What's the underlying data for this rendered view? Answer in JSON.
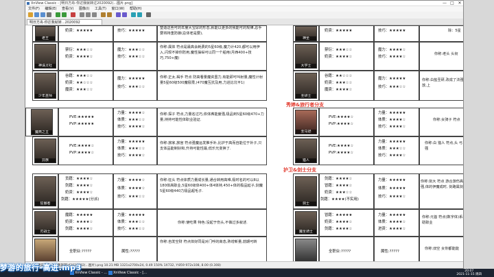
{
  "window": {
    "title": "XnView Classic - [明日方舟-你达我就转过2020092(...图片.png]",
    "tab_label": "明日方舟-你达我就转...2020092",
    "controls": {
      "minimize": "—",
      "maximize": "□",
      "close": "✕"
    }
  },
  "menu": [
    "文件(F)",
    "编辑(E)",
    "查看(V)",
    "图像(I)",
    "工具(T)",
    "窗口(W)",
    "帮助(H)"
  ],
  "sheet": {
    "sections": [
      {
        "name": "秀婷&旅行者分支"
      },
      {
        "name": "护卫&剑士分支"
      }
    ],
    "top_left_rows": [
      {
        "avatar_label": "老王",
        "stats": [
          "奶资：★★★★★"
        ],
        "skill": [
          "技巧：★★★★★"
        ],
        "desc": "塑造这些可的年度大宝尿的形态,就能以更多的我能可的规律,总手要将持重防御(总体老是要),"
      },
      {
        "avatar_label": "神诛灵社",
        "stats": [
          "禁衍：★★★☆☆",
          "奶资：★★★★☆"
        ],
        "skill": [
          "魔力：★★★☆☆",
          "技巧：★★★☆☆"
        ],
        "desc": "你称:属体 符点是最高会耗费的5星60级,魔力计420,都可以用伊入,闪现不掉你防用,魔性操纵可以同一个船用(月西400+技巧,750+魔)"
      },
      {
        "avatar_label": "少年巫师",
        "stats": [
          "谷籍：★★★☆☆",
          "奶资：★★☆☆☆",
          "魔资：★★★☆☆"
        ],
        "skill": [
          "魔力：★★★★★",
          "技巧：★★★☆☆"
        ],
        "desc": "你称:正太,褐手 符点 防高看量魔资虽力,有能即可叫射量,魔性计射量5星60级500魔极限,(470魔互抗及用,力进比坑平1)"
      },
      {
        "avatar_label": "魔燕之主",
        "stats": [
          "PVE:★★★★★",
          "PVP:★★★★★"
        ],
        "skill": [
          "力量：★★★★☆",
          "体质：★★★☆☆",
          "技巧：★★★★☆"
        ],
        "desc": "你称:探子 符点,力量名过巧,依体弗能度强,极品到5星60级470+力量,持持可能性体职业验证."
      },
      {
        "avatar_label": "异族",
        "stats": [
          "PVE:★★★★☆",
          "PVP:★★★★☆"
        ],
        "skill": [
          "力量：★★★★★",
          "体质：★★★☆☆",
          "技巧：★★★★☆"
        ],
        "desc": "你称:旅家,旅宫 符点强魔运发推手补,比护于高而自能位于补子,只支体品能制好和,升持可能性最,低乐光变换了."
      },
      {
        "avatar_label": "狂傲者",
        "stats": [
          "贡籍：★★★★☆",
          "剑籍：★★★★☆",
          "奶资：★★★★☆",
          "剑籍：★★★★★(分派)"
        ],
        "skill": [
          "力量：★★★★☆",
          "体质：★★★★☆",
          "技巧：★★★☆☆"
        ],
        "desc": "你称:狂头 符点体质力量成长量,通合转用高难,极时名的可以8以180体高职业,5星60级体400+体4体持,450+体的极品延子,剑魔5星60级440力极品超毛子."
      },
      {
        "avatar_label": "刃战士",
        "stats": [
          "魔籍：★★★★★",
          "奶资：★★★★☆",
          "剑籍：★★★★☆"
        ],
        "skill": [
          "力量：★★★★★",
          "体质：★★★☆☆",
          "技巧：★★★☆☆"
        ],
        "desc": "你称:使吃果 特色:没起于伤头,不做过多叙述."
      },
      {
        "avatar_label": "",
        "stats": [
          "全职业:?????"
        ],
        "skill": [
          "属性:?????"
        ],
        "desc": "你称:自发空财 符点体好同是对门呼的高态,熟增新量,前期可转"
      }
    ],
    "top_right_rows": [
      {
        "avatar_label": "神圣",
        "stats": [
          "奶资：★★★★★"
        ],
        "skill": [
          "技巧：★★★★★"
        ],
        "desc": "除：5星"
      },
      {
        "avatar_label": "大学士",
        "stats": [
          "禁衍：★★★☆☆",
          "奶资：★★★★☆"
        ],
        "skill": [
          "魔力：★★★★☆",
          "技巧：★★★★☆"
        ],
        "desc": "你称:老头 头衔"
      },
      {
        "avatar_label": "圣研士",
        "stats": [
          "谷籍：★★☆☆☆",
          "奶资：★★★☆☆",
          "魔资：★★★★☆"
        ],
        "skill": [
          "魔力：★★★★★",
          "技巧：★★★☆☆"
        ],
        "desc": "你称:白盐圣研,改成了法强解放,上"
      },
      {
        "avatar_label": "圣马逊",
        "stats": [
          "PVE:★★★★☆",
          "PVP:★★★★☆"
        ],
        "skill": [
          "力量：★★★★★",
          "体质：★★★★☆",
          "技巧：★★★★☆"
        ],
        "desc": "你称:女骑子 符点"
      },
      {
        "avatar_label": "猎人",
        "stats": [
          "PVE:★★★★☆",
          "PVP:★★★★☆"
        ],
        "skill": [
          "力量：★★★★★",
          "体质：★★★☆☆",
          "技巧：★★★★☆"
        ],
        "desc": "你称:白 猎人 符点,头 弓强"
      },
      {
        "avatar_label": "剑士",
        "stats": [
          "剑籍：★★★★☆",
          "冒籍：★★★★☆",
          "奶资：★★★☆☆",
          "剑籍：★★★★(不实用)"
        ],
        "skill": [
          "力量：★★★★★",
          "体质：★★★★★",
          "技巧：★★★★☆"
        ],
        "desc": "你称:剑大 符点 游合游伤高强,体的伊魔成时, 剑路属剑器"
      },
      {
        "avatar_label": "魔圣骑士",
        "stats": [
          "冒籍：★★★★★",
          "奶资：★★★★☆",
          "剑籍：★★★★☆"
        ],
        "skill": [
          "力量：★★★★★",
          "体质：★★★★☆",
          "进资：★★★★☆"
        ],
        "desc": "你称:元首 符点(数字体)系辅助职业"
      },
      {
        "avatar_label": "",
        "stats": [
          "全职业:?????"
        ],
        "skill": [
          "属性:?????"
        ],
        "desc": "你称:双空 女你都能能"
      }
    ]
  },
  "statusbar": "41/79   明日方舟-你达我就转过2020092(...图片).png   10.21 MB   1321x2700x24, 0.49   150%   1X732, Y:859   972x108, 8.00 (0.308)",
  "taskbar": {
    "buttons": [
      {
        "label": "XnView Classic - ...",
        "color": "#2e7bd6"
      },
      {
        "label": "XnView Classic - [...",
        "color": "#2e7bd6"
      }
    ],
    "clock_time": "20:07",
    "clock_date": "2021-11-15 周四"
  },
  "overlay_caption": "梦游的旅行-高进.mp3"
}
